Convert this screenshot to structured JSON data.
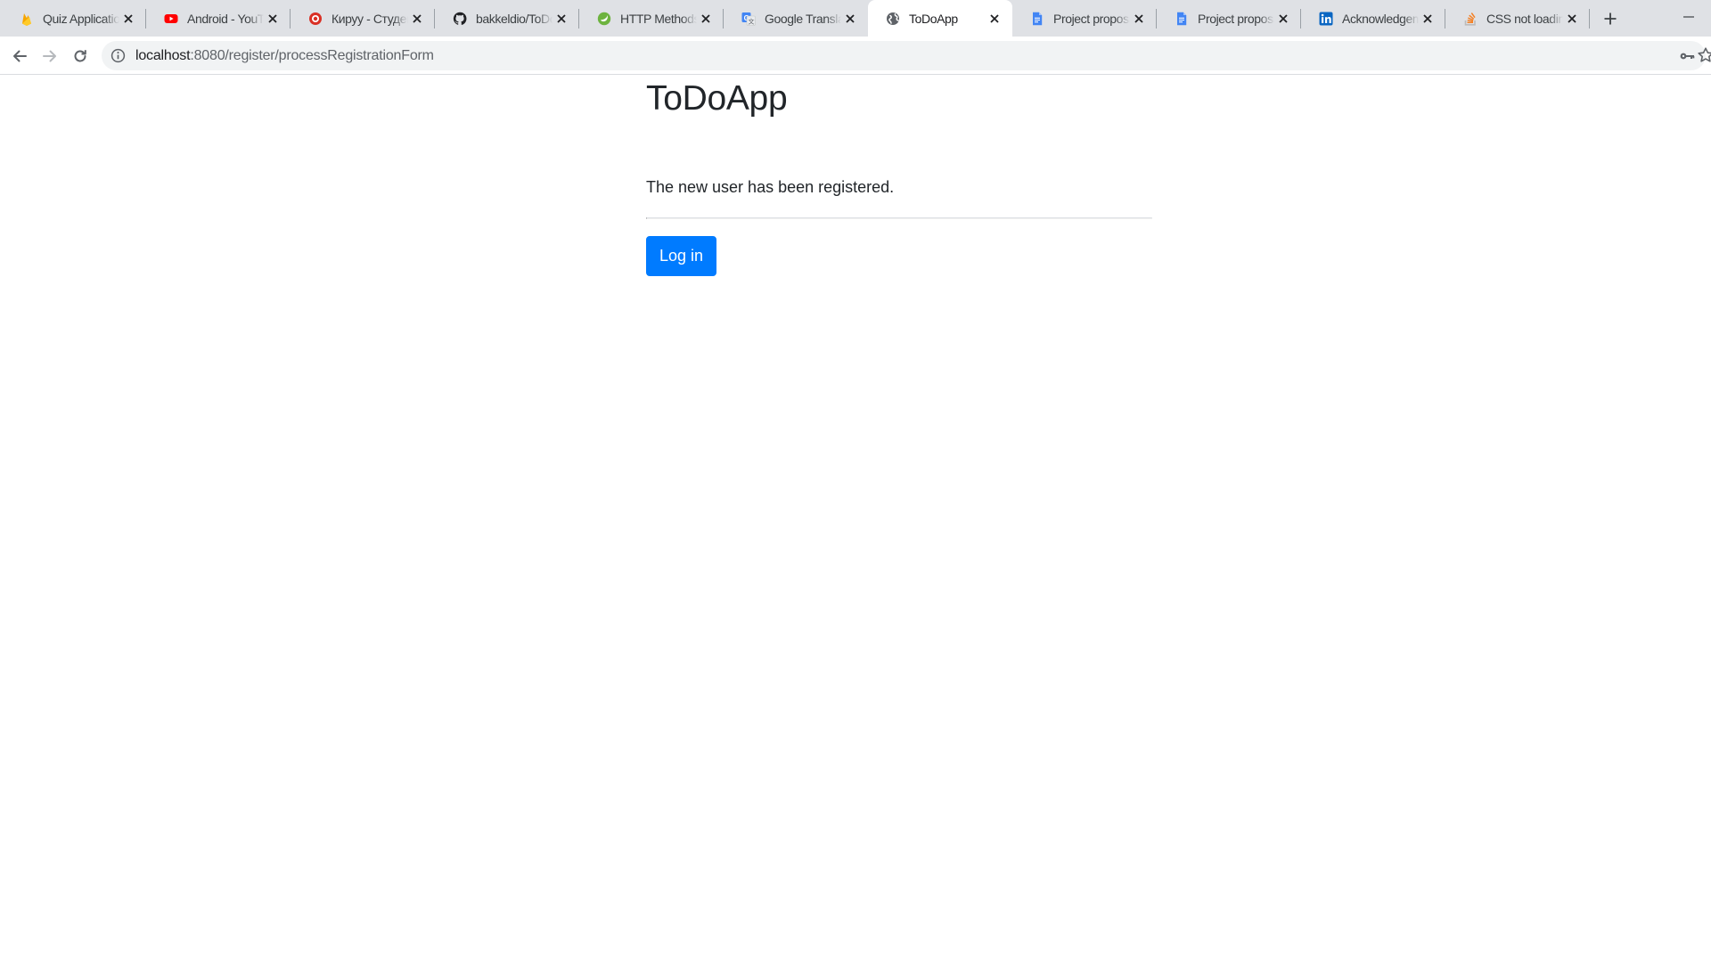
{
  "browser": {
    "tabs": [
      {
        "title": "Quiz Application",
        "icon": "firebase-icon",
        "color": "#f6a500"
      },
      {
        "title": "Android - YouTube",
        "icon": "youtube-icon",
        "color": "#ff0000"
      },
      {
        "title": "Кируу - Студенттер",
        "icon": "record-icon",
        "color": "#d93025"
      },
      {
        "title": "bakkeldio/ToDoApp",
        "icon": "github-icon",
        "color": "#202124"
      },
      {
        "title": "HTTP Methods - Spring",
        "icon": "spring-icon",
        "color": "#6db33f"
      },
      {
        "title": "Google Translate",
        "icon": "google-translate-icon",
        "color": "#4285f4"
      },
      {
        "title": "ToDoApp",
        "icon": "globe-icon",
        "color": "#5f6368",
        "active": true
      },
      {
        "title": "Project proposal",
        "icon": "google-docs-icon",
        "color": "#4285f4"
      },
      {
        "title": "Project proposal",
        "icon": "google-docs-icon",
        "color": "#4285f4"
      },
      {
        "title": "Acknowledgements",
        "icon": "linkedin-icon",
        "color": "#0a66c2"
      },
      {
        "title": "CSS not loading",
        "icon": "stackoverflow-icon",
        "color": "#f48024"
      }
    ],
    "address": {
      "host": "localhost",
      "path": ":8080/register/processRegistrationForm"
    }
  },
  "page": {
    "app_title": "ToDoApp",
    "message": "The new user has been registered.",
    "login_button": "Log in"
  },
  "colors": {
    "primary": "#007bff",
    "text": "#212529",
    "divider": "#dee2e6",
    "tabstrip": "#dfe1e5"
  }
}
